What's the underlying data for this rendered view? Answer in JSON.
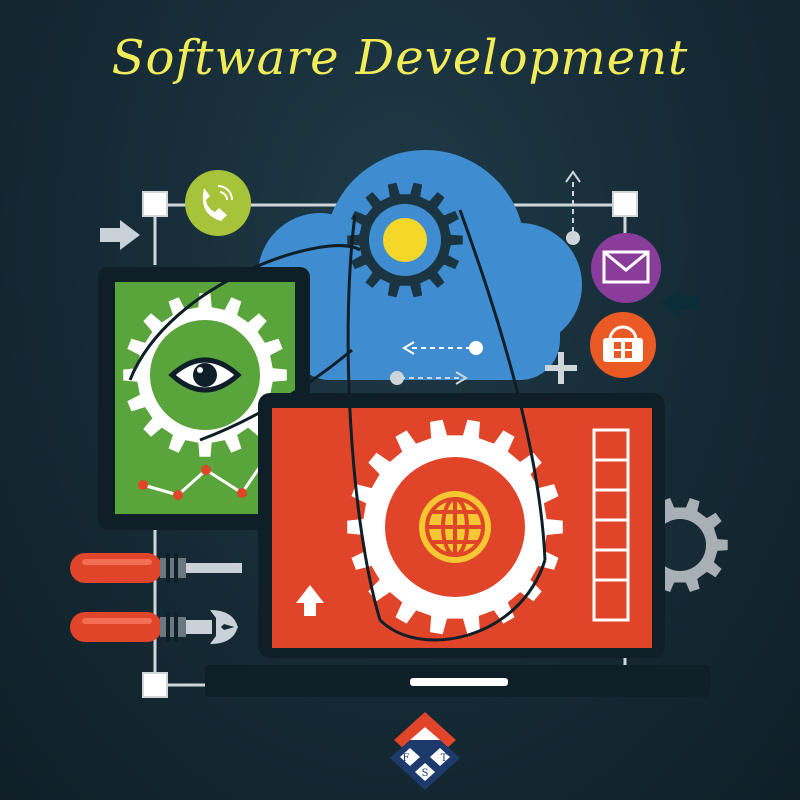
{
  "title": "Software Development",
  "colors": {
    "title": "#f2ec5a",
    "background": "#162b36",
    "green": "#5aa43c",
    "red": "#e0452a",
    "blue": "#3f8dd0",
    "purple": "#8a3c9a",
    "orange": "#ea5a24",
    "yellow_green": "#a6c33a",
    "gear_white": "#ffffff",
    "line": "#d9dde0",
    "dark": "#0f1f27"
  },
  "logo": {
    "letters": [
      "F",
      "S",
      "T"
    ]
  }
}
